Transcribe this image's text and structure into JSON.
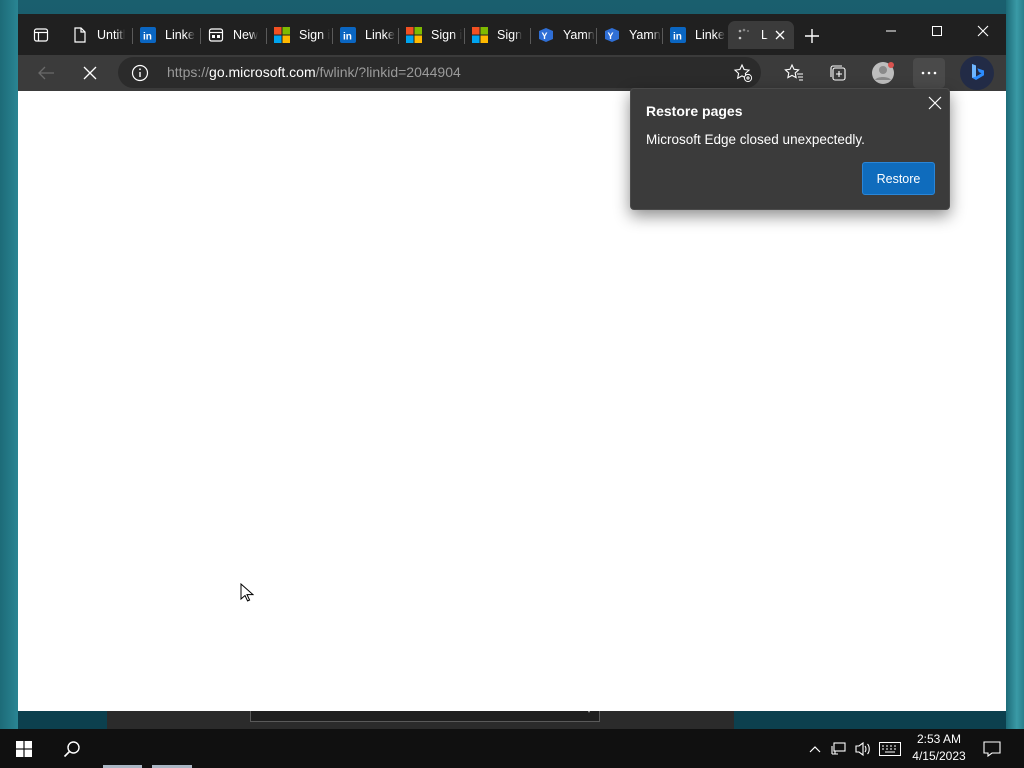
{
  "browser": {
    "tabs": [
      {
        "label": "Untitl",
        "icon": "page-icon"
      },
      {
        "label": "Linke",
        "icon": "linkedin-icon"
      },
      {
        "label": "New",
        "icon": "newtab-icon"
      },
      {
        "label": "Sign i",
        "icon": "microsoft-icon"
      },
      {
        "label": "Linke",
        "icon": "linkedin-icon"
      },
      {
        "label": "Sign i",
        "icon": "microsoft-icon"
      },
      {
        "label": "Sign",
        "icon": "microsoft-icon"
      },
      {
        "label": "Yamn",
        "icon": "yammer-icon"
      },
      {
        "label": "Yamn",
        "icon": "yammer-icon"
      },
      {
        "label": "Linke",
        "icon": "linkedin-icon"
      },
      {
        "label": "L",
        "icon": "loading-icon",
        "active": true
      }
    ],
    "address": {
      "prefix": "https://",
      "domain": "go.microsoft.com",
      "path": "/fwlink/?linkid=2044904"
    }
  },
  "popup": {
    "title": "Restore pages",
    "message": "Microsoft Edge closed unexpectedly.",
    "restore_label": "Restore"
  },
  "taskbar": {
    "time": "2:53 AM",
    "date": "4/15/2023"
  },
  "colors": {
    "accent": "#0f6cbd",
    "titlebar": "#202020",
    "toolbar": "#3b3b3b"
  }
}
